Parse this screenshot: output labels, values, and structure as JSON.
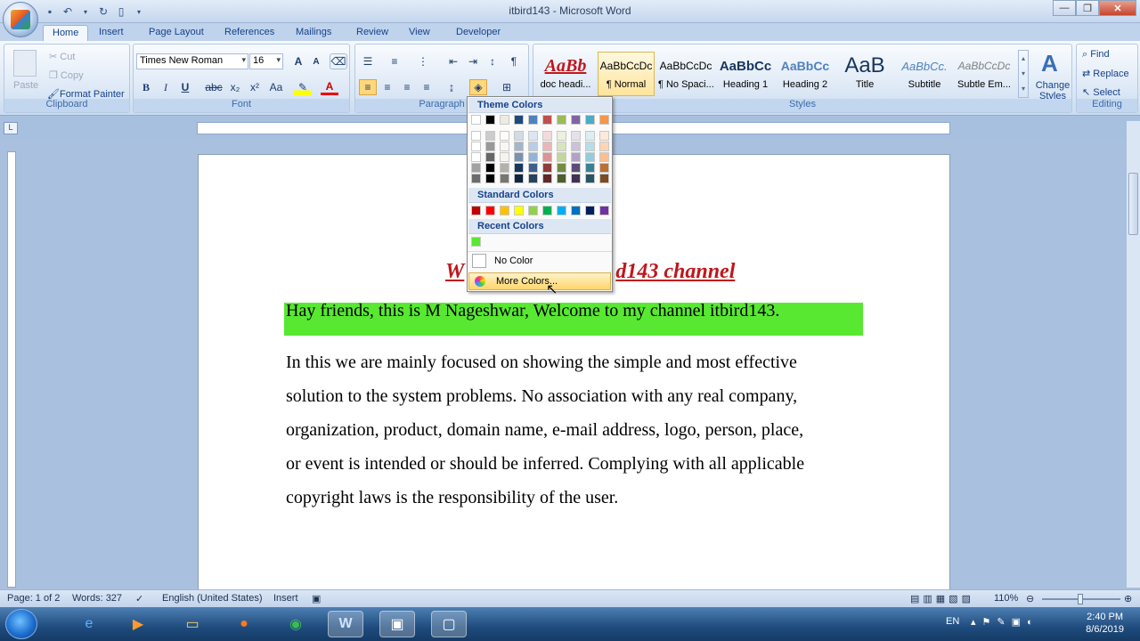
{
  "window": {
    "title": "itbird143 - Microsoft Word"
  },
  "tabs": [
    "Home",
    "Insert",
    "Page Layout",
    "References",
    "Mailings",
    "Review",
    "View",
    "Developer"
  ],
  "clipboard": {
    "paste": "Paste",
    "cut": "Cut",
    "copy": "Copy",
    "format_painter": "Format Painter",
    "label": "Clipboard"
  },
  "font": {
    "name": "Times New Roman",
    "size": "16",
    "label": "Font",
    "bold": "B",
    "italic": "I",
    "underline": "U"
  },
  "paragraph": {
    "label": "Paragraph"
  },
  "styles": {
    "label": "Styles",
    "items": [
      {
        "preview": "AaBb",
        "name": "doc headi..."
      },
      {
        "preview": "AaBbCcDc",
        "name": "¶ Normal"
      },
      {
        "preview": "AaBbCcDc",
        "name": "¶ No Spaci..."
      },
      {
        "preview": "AaBbCc",
        "name": "Heading 1"
      },
      {
        "preview": "AaBbCc",
        "name": "Heading 2"
      },
      {
        "preview": "AaB",
        "name": "Title"
      },
      {
        "preview": "AaBbCc.",
        "name": "Subtitle"
      },
      {
        "preview": "AaBbCcDc",
        "name": "Subtle Em..."
      }
    ],
    "change_styles": "Change Styles"
  },
  "editing": {
    "find": "Find",
    "replace": "Replace",
    "select": "Select",
    "label": "Editing"
  },
  "color_menu": {
    "theme_header": "Theme Colors",
    "standard_header": "Standard Colors",
    "recent_header": "Recent Colors",
    "no_color": "No Color",
    "more_colors": "More Colors...",
    "theme_top": [
      "#ffffff",
      "#000000",
      "#eeece1",
      "#1f497d",
      "#4f81bd",
      "#c0504d",
      "#9bbb59",
      "#8064a2",
      "#4bacc6",
      "#f79646"
    ],
    "standard": [
      "#c00000",
      "#ff0000",
      "#ffc000",
      "#ffff00",
      "#92d050",
      "#00b050",
      "#00b0f0",
      "#0070c0",
      "#002060",
      "#7030a0"
    ],
    "recent": [
      "#58e832"
    ]
  },
  "document": {
    "title_left": "W",
    "title_right": "d143 channel",
    "highlighted_line": "Hay friends, this is M Nageshwar, Welcome to my channel itbird143.",
    "body_lines": [
      "In this we are mainly focused on showing the simple and most effective",
      "solution to the system problems. No association with any real company,",
      "organization, product, domain name, e-mail address, logo, person, place,",
      "or event is intended or should be inferred. Complying with all applicable",
      "copyright laws is the responsibility of the user."
    ],
    "highlight_color": "#58e832",
    "title_color": "#c0161c"
  },
  "statusbar": {
    "page": "Page: 1 of 2",
    "words": "Words: 327",
    "language": "English (United States)",
    "mode": "Insert",
    "zoom": "110%"
  },
  "taskbar": {
    "lang": "EN",
    "time": "2:40 PM",
    "date": "8/6/2019"
  }
}
